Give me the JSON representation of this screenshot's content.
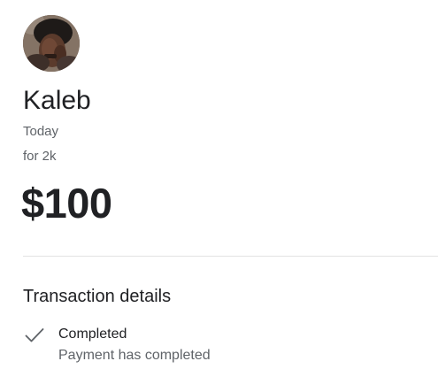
{
  "contact": {
    "avatar_icon": "user-photo",
    "name": "Kaleb"
  },
  "transaction": {
    "date": "Today",
    "note": "for 2k",
    "amount": "$100"
  },
  "details": {
    "section_title": "Transaction details",
    "status": {
      "icon": "check-icon",
      "title": "Completed",
      "subtitle": "Payment has completed"
    }
  },
  "colors": {
    "primary_text": "#202124",
    "secondary_text": "#5f6368",
    "divider": "#e3e3e3",
    "check": "#5f6368"
  }
}
